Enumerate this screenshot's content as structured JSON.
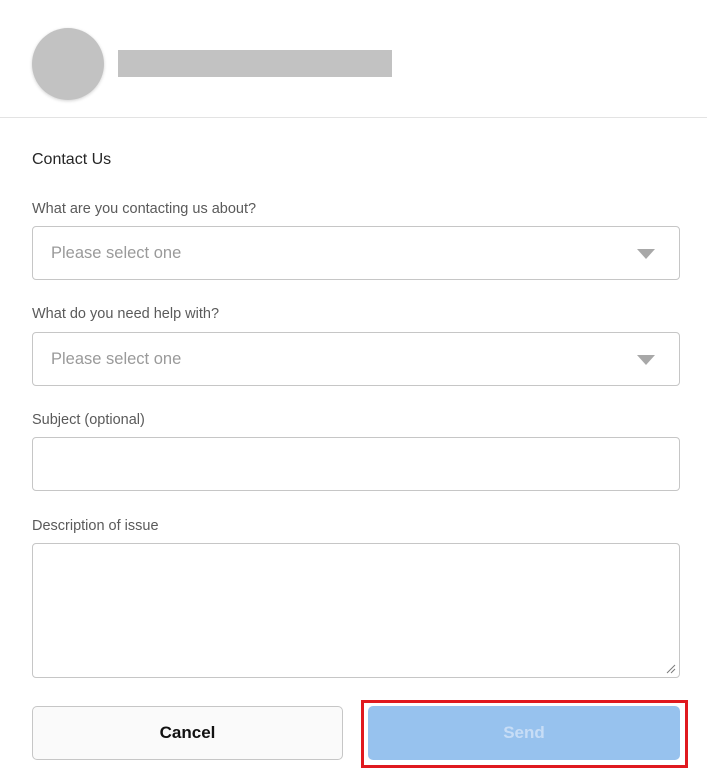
{
  "header": {
    "avatar": "avatar-placeholder",
    "name": ""
  },
  "form": {
    "title": "Contact Us",
    "fields": {
      "topic": {
        "label": "What are you contacting us about?",
        "value": "Please select one",
        "icon": "chevron-down-icon"
      },
      "help": {
        "label": "What do you need help with?",
        "value": "Please select one",
        "icon": "chevron-down-icon"
      },
      "subject": {
        "label": "Subject (optional)",
        "value": ""
      },
      "description": {
        "label": "Description of issue",
        "value": ""
      }
    },
    "buttons": {
      "cancel": "Cancel",
      "send": "Send"
    }
  },
  "colors": {
    "send_button_bg": "#97c2ee",
    "send_button_text": "#c7ddf6",
    "highlight_border": "#e0191f",
    "placeholder_gray": "#c2c2c2"
  }
}
